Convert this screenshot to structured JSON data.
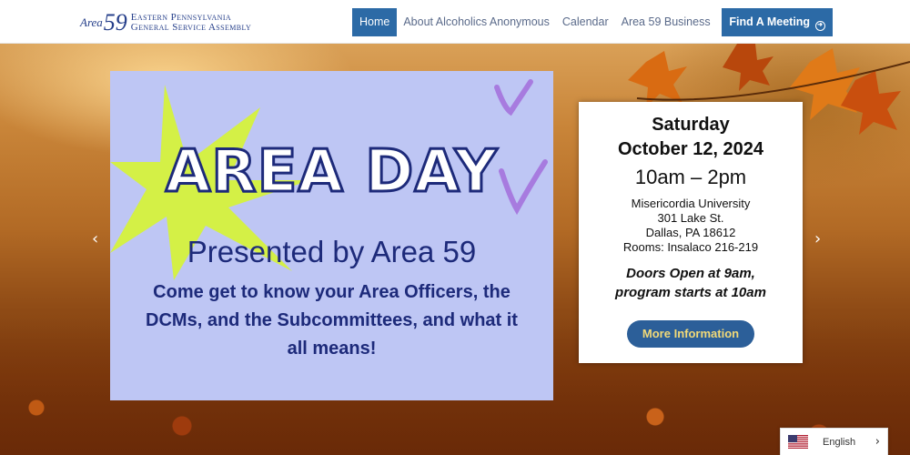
{
  "header": {
    "logo": {
      "area_word": "Area",
      "area_number": "59",
      "line1": "Eastern Pennsylvania",
      "line2": "General Service Assembly"
    },
    "nav": [
      {
        "label": "Home",
        "active": true
      },
      {
        "label": "About Alcoholics Anonymous",
        "active": false
      },
      {
        "label": "Calendar",
        "active": false
      },
      {
        "label": "Area 59 Business",
        "active": false
      }
    ],
    "cta": {
      "label": "Find A Meeting",
      "icon": "arrow-circle-right-icon"
    }
  },
  "slide": {
    "title": "AREA DAY",
    "subtitle": "Presented by Area 59",
    "body": "Come get to know your Area Officers, the DCMs, and the Subcommittees, and what it all means!"
  },
  "event": {
    "day": "Saturday",
    "date": "October 12, 2024",
    "time": "10am – 2pm",
    "venue": "Misericordia University",
    "street": "301 Lake St.",
    "city": "Dallas, PA 18612",
    "rooms": "Rooms: Insalaco 216-219",
    "doors": "Doors Open at 9am,",
    "program": "program starts at 10am",
    "button": "More Information"
  },
  "carousel": {
    "prev_icon": "chevron-left-icon",
    "next_icon": "chevron-right-icon"
  },
  "language": {
    "label": "English",
    "flag_icon": "us-flag-icon",
    "chevron_icon": "chevron-right-icon"
  },
  "colors": {
    "brand_blue": "#2c6aa6",
    "slide_bg": "#bec6f4",
    "slide_text": "#1d2a7a",
    "accent_yellow": "#d4f046",
    "button_text": "#f1d978"
  }
}
